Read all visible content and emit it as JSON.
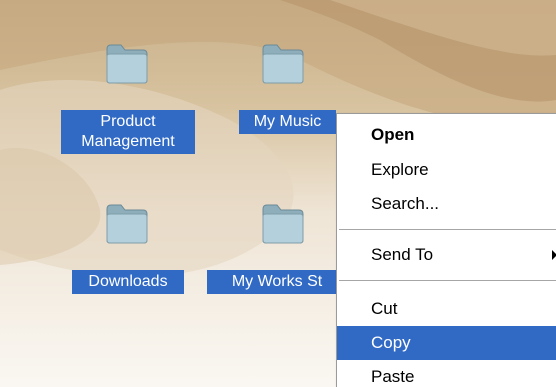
{
  "desktop": {
    "icons": [
      {
        "label_lines": [
          "Product",
          "Management"
        ],
        "icon": "folder-icon"
      },
      {
        "label_lines": [
          "My Music"
        ],
        "icon": "folder-icon"
      },
      {
        "label_lines": [
          "Downloads"
        ],
        "icon": "folder-icon"
      },
      {
        "label_lines": [
          "My Works St"
        ],
        "icon": "folder-icon"
      }
    ]
  },
  "context_menu": {
    "items": [
      {
        "label": "Open",
        "bold": true
      },
      {
        "label": "Explore"
      },
      {
        "label": "Search..."
      },
      {
        "label": "Send To",
        "submenu": true
      },
      {
        "label": "Cut"
      },
      {
        "label": "Copy",
        "highlighted": true
      },
      {
        "label": "Paste"
      }
    ]
  },
  "colors": {
    "selection": "#316ac5",
    "folder_fill": "#a9c6d2"
  }
}
